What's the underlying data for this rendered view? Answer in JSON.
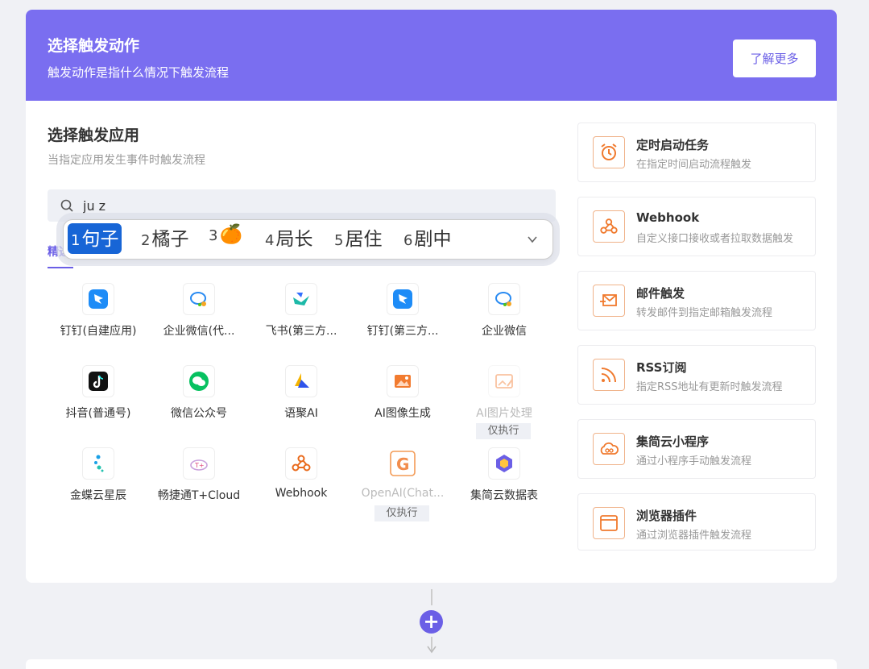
{
  "banner": {
    "title": "选择触发动作",
    "subtitle": "触发动作是指什么情况下触发流程",
    "more_label": "了解更多"
  },
  "app_section": {
    "title": "选择触发应用",
    "subtitle": "当指定应用发生事件时触发流程",
    "search_value": "ju z",
    "tab_label": "精选"
  },
  "ime": {
    "candidates": [
      {
        "num": "1",
        "word": "句子"
      },
      {
        "num": "2",
        "word": "橘子"
      },
      {
        "num": "3",
        "word": "🍊"
      },
      {
        "num": "4",
        "word": "局长"
      },
      {
        "num": "5",
        "word": "居住"
      },
      {
        "num": "6",
        "word": "剧中"
      }
    ]
  },
  "apps": [
    {
      "label": "钉钉(自建应用)",
      "icon": "dingtalk-icon"
    },
    {
      "label": "企业微信(代...",
      "icon": "wecom-icon"
    },
    {
      "label": "飞书(第三方...",
      "icon": "feishu-icon"
    },
    {
      "label": "钉钉(第三方...",
      "icon": "dingtalk-icon"
    },
    {
      "label": "企业微信",
      "icon": "wecom-icon"
    },
    {
      "label": "抖音(普通号)",
      "icon": "douyin-icon"
    },
    {
      "label": "微信公众号",
      "icon": "wechat-icon"
    },
    {
      "label": "语聚AI",
      "icon": "yuju-ai-icon"
    },
    {
      "label": "AI图像生成",
      "icon": "ai-image-icon"
    },
    {
      "label": "AI图片处理",
      "icon": "ai-image-edit-icon",
      "tag": "仅执行"
    },
    {
      "label": "金蝶云星辰",
      "icon": "kingdee-icon"
    },
    {
      "label": "畅捷通T+Cloud",
      "icon": "chanjet-icon"
    },
    {
      "label": "Webhook",
      "icon": "webhook-icon"
    },
    {
      "label": "OpenAI(Chat...",
      "icon": "openai-icon",
      "tag": "仅执行"
    },
    {
      "label": "集简云数据表",
      "icon": "jijian-table-icon"
    }
  ],
  "triggers": [
    {
      "name": "定时启动任务",
      "desc": "在指定时间启动流程触发",
      "icon": "alarm-clock-icon"
    },
    {
      "name": "Webhook",
      "desc": "自定义接口接收或者拉取数据触发",
      "icon": "webhook-icon"
    },
    {
      "name": "邮件触发",
      "desc": "转发邮件到指定邮箱触发流程",
      "icon": "mail-icon"
    },
    {
      "name": "RSS订阅",
      "desc": "指定RSS地址有更新时触发流程",
      "icon": "rss-icon"
    },
    {
      "name": "集简云小程序",
      "desc": "通过小程序手动触发流程",
      "icon": "cloud-miniapp-icon"
    },
    {
      "name": "浏览器插件",
      "desc": "通过浏览器插件触发流程",
      "icon": "browser-icon"
    }
  ],
  "colors": {
    "accent": "#6b5fe6",
    "banner": "#7a6ef0",
    "trigger_orange": "#f07a2e"
  }
}
